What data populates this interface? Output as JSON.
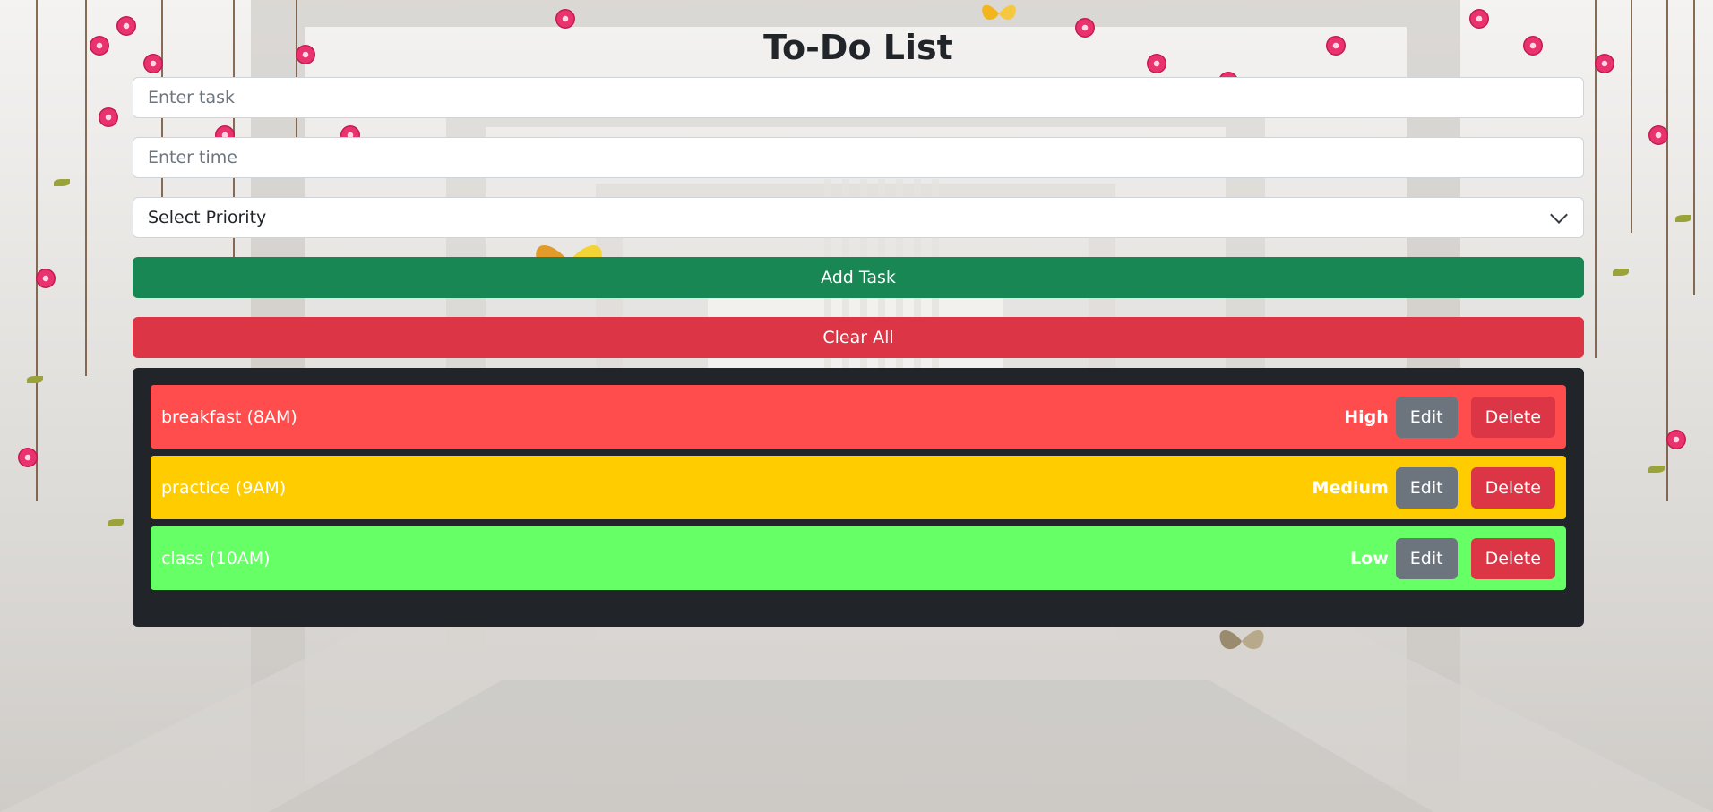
{
  "app": {
    "title": "To-Do List"
  },
  "form": {
    "task_placeholder": "Enter task",
    "task_value": "",
    "time_placeholder": "Enter time",
    "time_value": "",
    "priority_selected": "Select Priority",
    "add_label": "Add Task",
    "clear_label": "Clear All"
  },
  "tasks": [
    {
      "text": "breakfast (8AM)",
      "priority": "High",
      "edit_label": "Edit",
      "delete_label": "Delete",
      "color": "#ff4d4d"
    },
    {
      "text": "practice (9AM)",
      "priority": "Medium",
      "edit_label": "Edit",
      "delete_label": "Delete",
      "color": "#ffcc00"
    },
    {
      "text": "class (10AM)",
      "priority": "Low",
      "edit_label": "Edit",
      "delete_label": "Delete",
      "color": "#66ff66"
    }
  ],
  "colors": {
    "add_button": "#198754",
    "clear_button": "#dc3545",
    "list_background": "#212529",
    "edit_button": "#6c757d",
    "delete_button": "#dc3545"
  }
}
